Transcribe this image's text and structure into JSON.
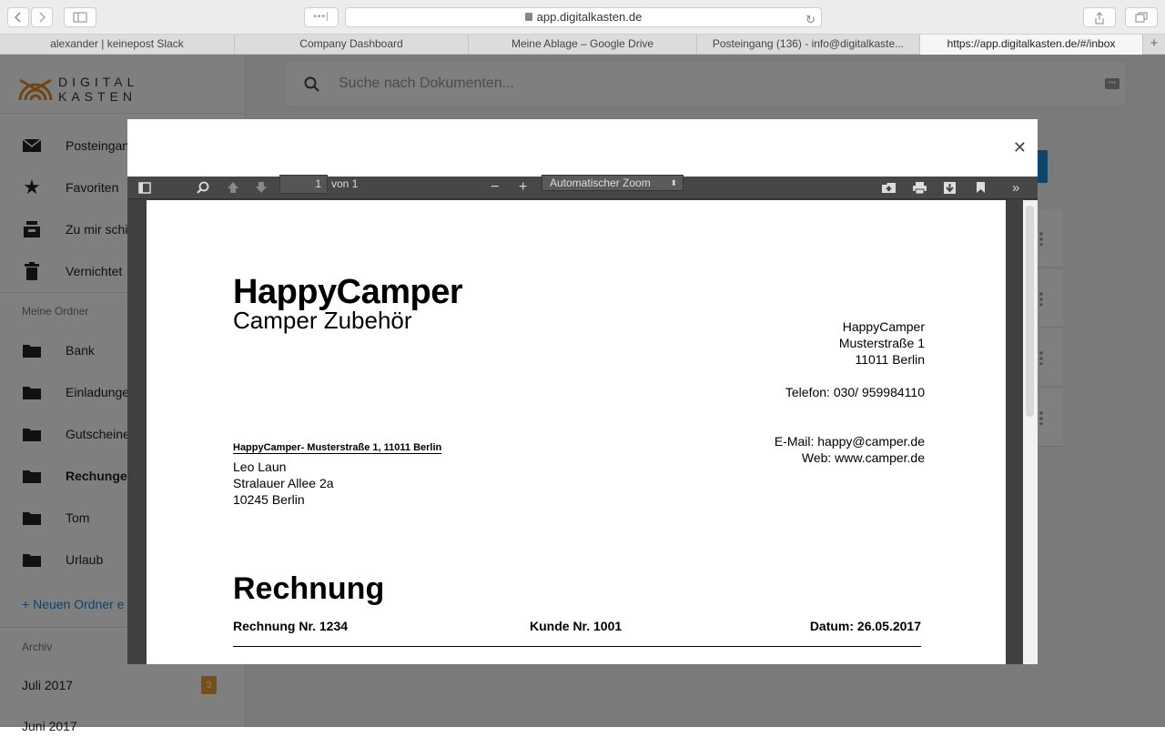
{
  "browser": {
    "url": "app.digitalkasten.de",
    "tabs": [
      {
        "label": "alexander | keinepost Slack"
      },
      {
        "label": "Company Dashboard"
      },
      {
        "label": "Meine Ablage – Google Drive"
      },
      {
        "label": "Posteingang (136) - info@digitalkaste..."
      },
      {
        "label": "https://app.digitalkasten.de/#/inbox"
      }
    ]
  },
  "app": {
    "logo": {
      "line1": "DIGITAL",
      "line2": "KASTEN"
    },
    "search_placeholder": "Suche nach Dokumenten...",
    "nav": [
      {
        "label": "Posteingang",
        "icon": "mail-icon"
      },
      {
        "label": "Favoriten",
        "icon": "star-icon"
      },
      {
        "label": "Zu mir schi",
        "icon": "inbox-tray-icon"
      },
      {
        "label": "Vernichtet",
        "icon": "trash-icon"
      }
    ],
    "folders_header": "Meine Ordner",
    "folders": [
      {
        "label": "Bank"
      },
      {
        "label": "Einladunge"
      },
      {
        "label": "Gutscheine"
      },
      {
        "label": "Rechungen"
      },
      {
        "label": "Tom"
      },
      {
        "label": "Urlaub"
      }
    ],
    "new_folder": "Neuen Ordner e",
    "archive_header": "Archiv",
    "archive": [
      {
        "label": "Juli 2017",
        "count": "3"
      },
      {
        "label": "Juni 2017"
      }
    ]
  },
  "viewer": {
    "page_number": "1",
    "page_of": "von 1",
    "zoom": "Automatischer Zoom"
  },
  "document": {
    "company": "HappyCamper",
    "tagline": "Camper Zubehör",
    "sender_address": [
      "HappyCamper",
      "Musterstraße 1",
      "11011 Berlin"
    ],
    "phone": "Telefon: 030/ 959984110",
    "email": "E-Mail: happy@camper.de",
    "web": "Web: www.camper.de",
    "sender_line": "HappyCamper- Musterstraße 1, 11011 Berlin",
    "recipient": [
      "Leo Laun",
      "Stralauer Allee 2a",
      "10245 Berlin"
    ],
    "heading": "Rechnung",
    "invoice_no": "Rechnung Nr. 1234",
    "customer_no": "Kunde Nr. 1001",
    "date": "Datum: 26.05.2017"
  },
  "colors": {
    "accent": "#1a8bd6",
    "badge": "#e8a033",
    "logo": "#e08a2c"
  }
}
